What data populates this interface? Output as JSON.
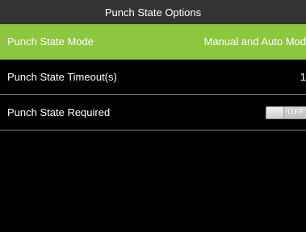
{
  "title": "Punch State Options",
  "items": [
    {
      "label": "Punch State Mode",
      "value": "Manual and Auto Mod"
    },
    {
      "label": "Punch State Timeout(s)",
      "value": "1"
    },
    {
      "label": "Punch State Required",
      "toggle_text": "OFF"
    }
  ],
  "colors": {
    "selected_row": "#8dc63f",
    "title_bar": "#333333",
    "background": "#000000"
  }
}
